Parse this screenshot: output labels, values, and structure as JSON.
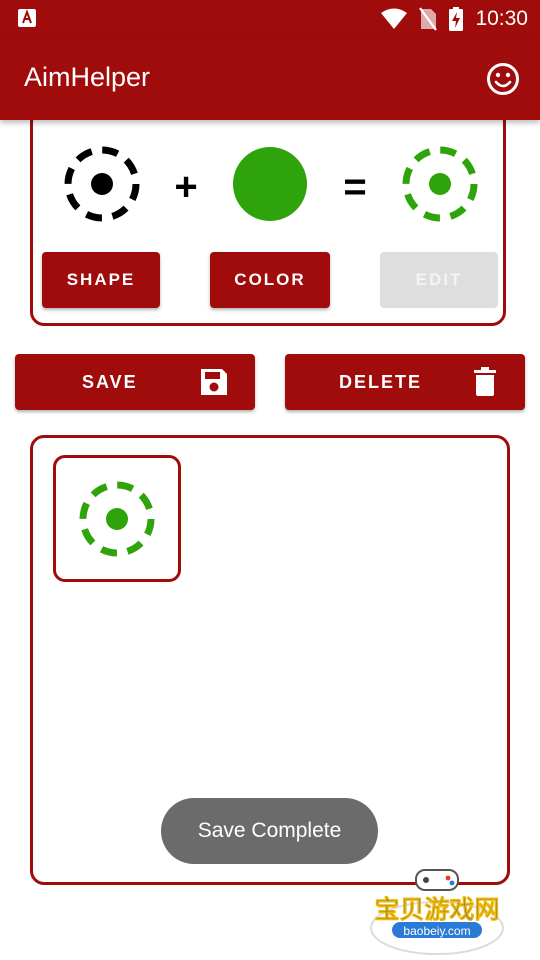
{
  "status_bar": {
    "time": "10:30",
    "icons": [
      "app-notification-icon",
      "wifi-icon",
      "no-sim-icon",
      "battery-charging-icon"
    ]
  },
  "app_bar": {
    "title": "AimHelper",
    "action_icon": "smiley-icon"
  },
  "combo": {
    "plus": "+",
    "equals": "=",
    "shape_color": "#000000",
    "selected_color": "#2ea30c"
  },
  "buttons": {
    "shape": "SHAPE",
    "color": "COLOR",
    "edit": "EDIT",
    "save": "SAVE",
    "delete": "DELETE"
  },
  "saved": {
    "items": [
      {
        "color": "#2ea30c"
      }
    ]
  },
  "toast": "Save Complete",
  "watermark": {
    "text": "宝贝游戏网",
    "url": "baobeiy.com"
  },
  "colors": {
    "primary": "#a00b0b",
    "disabled": "#dedede",
    "toast": "#6b6b6b"
  }
}
